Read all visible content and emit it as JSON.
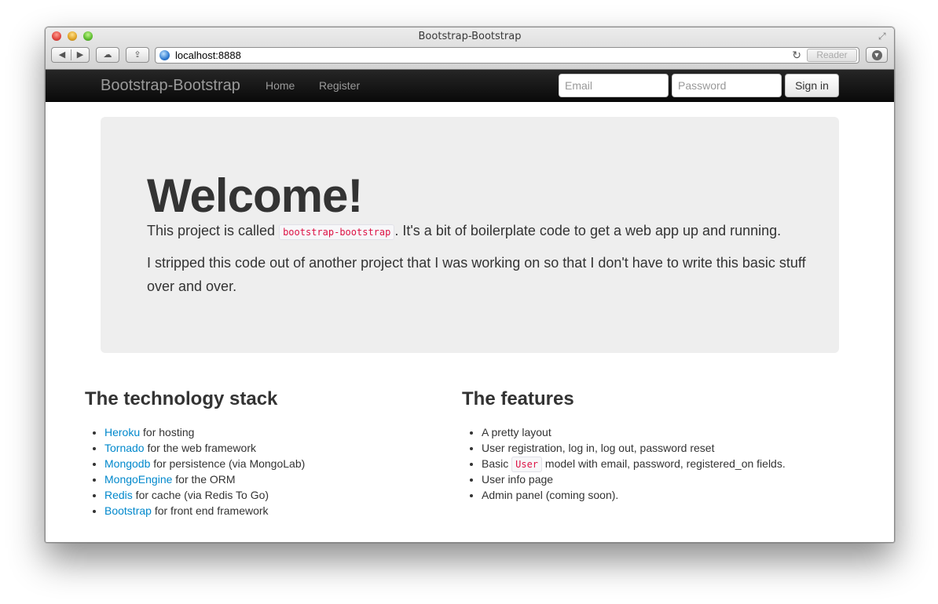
{
  "window": {
    "title": "Bootstrap-Bootstrap",
    "address": "localhost:8888",
    "reader_label": "Reader"
  },
  "navbar": {
    "brand": "Bootstrap-Bootstrap",
    "links": [
      "Home",
      "Register"
    ],
    "email_placeholder": "Email",
    "password_placeholder": "Password",
    "signin_label": "Sign in"
  },
  "hero": {
    "heading": "Welcome!",
    "p1_before": "This project is called ",
    "p1_code": "bootstrap-bootstrap",
    "p1_after": ". It's a bit of boilerplate code to get a web app up and running.",
    "p2": "I stripped this code out of another project that I was working on so that I don't have to write this basic stuff over and over."
  },
  "stack": {
    "heading": "The technology stack",
    "items": [
      {
        "link": "Heroku",
        "text": " for hosting"
      },
      {
        "link": "Tornado",
        "text": " for the web framework"
      },
      {
        "link": "Mongodb",
        "text": " for persistence (via MongoLab)"
      },
      {
        "link": "MongoEngine",
        "text": " for the ORM"
      },
      {
        "link": "Redis",
        "text": " for cache (via Redis To Go)"
      },
      {
        "link": "Bootstrap",
        "text": " for front end framework"
      }
    ]
  },
  "features": {
    "heading": "The features",
    "item1": "A pretty layout",
    "item2": "User registration, log in, log out, password reset",
    "item3_before": "Basic ",
    "item3_code": "User",
    "item3_after": " model with email, password, registered_on fields.",
    "item4": "User info page",
    "item5": "Admin panel (coming soon)."
  },
  "colors": {
    "link": "#0088cc",
    "code": "#dd1144",
    "navbar": "#111111",
    "hero_bg": "#eeeeee"
  }
}
